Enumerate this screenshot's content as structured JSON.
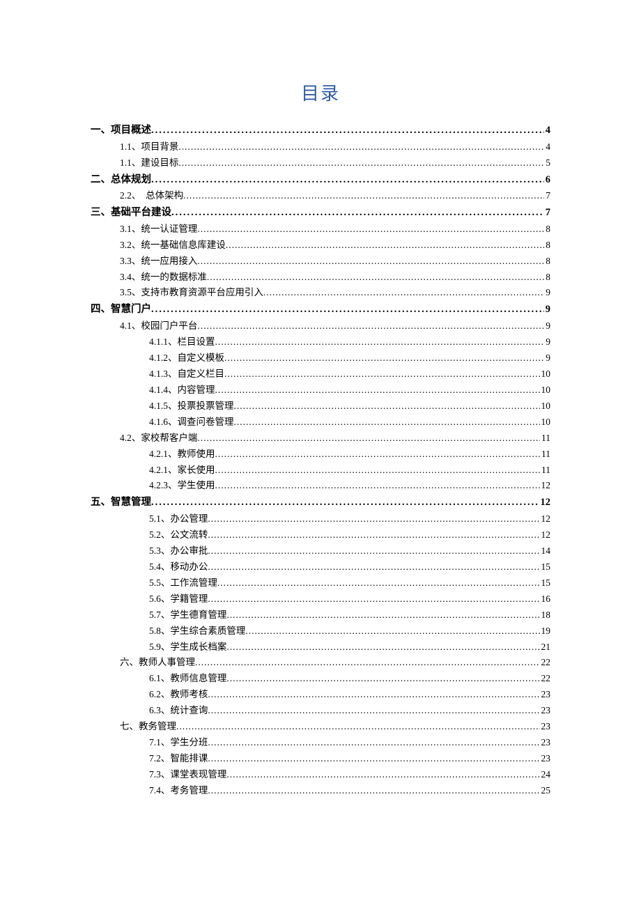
{
  "title": "目录",
  "entries": [
    {
      "level": 1,
      "label": "一、项目概述",
      "page": "4"
    },
    {
      "level": 2,
      "label": "1.1、项目背景",
      "page": "4"
    },
    {
      "level": 2,
      "label": "1.1、建设目标",
      "page": "5"
    },
    {
      "level": 1,
      "label": "二、总体规划",
      "page": "6"
    },
    {
      "level": 2,
      "label": "2.2、　总体架构",
      "page": "7"
    },
    {
      "level": 1,
      "label": "三、基础平台建设",
      "page": "7"
    },
    {
      "level": 2,
      "label": "3.1、统一认证管理",
      "page": "8"
    },
    {
      "level": 2,
      "label": "3.2、统一基础信息库建设",
      "page": "8"
    },
    {
      "level": 2,
      "label": "3.3、统一应用接入",
      "page": "8"
    },
    {
      "level": 2,
      "label": "3.4、统一的数据标准",
      "page": "8"
    },
    {
      "level": 2,
      "label": "3.5、支持市教育资源平台应用引入",
      "page": "9"
    },
    {
      "level": 1,
      "label": "四、智慧门户",
      "page": "9"
    },
    {
      "level": 2,
      "label": "4.1、校园门户平台",
      "page": "9"
    },
    {
      "level": 3,
      "label": "4.1.1、栏目设置",
      "page": "9"
    },
    {
      "level": 3,
      "label": "4.1.2、自定义模板",
      "page": "9"
    },
    {
      "level": 3,
      "label": "4.1.3、自定义栏目",
      "page": "10"
    },
    {
      "level": 3,
      "label": "4.1.4、内容管理",
      "page": "10"
    },
    {
      "level": 3,
      "label": "4.1.5、投票投票管理",
      "page": "10"
    },
    {
      "level": 3,
      "label": "4.1.6、调查问卷管理",
      "page": "10"
    },
    {
      "level": 2,
      "label": "4.2、家校帮客户端",
      "page": "11"
    },
    {
      "level": 3,
      "label": "4.2.1、教师使用",
      "page": "11"
    },
    {
      "level": 3,
      "label": "4.2.1、家长使用",
      "page": "11"
    },
    {
      "level": 3,
      "label": "4.2.3、学生使用",
      "page": "12"
    },
    {
      "level": 1,
      "label": "五、智慧管理",
      "page": "12"
    },
    {
      "level": 3,
      "label": "5.1、办公管理",
      "page": "12"
    },
    {
      "level": 3,
      "label": "5.2、公文流转",
      "page": "12"
    },
    {
      "level": 3,
      "label": "5.3、办公审批",
      "page": "14"
    },
    {
      "level": 3,
      "label": "5.4、移动办公",
      "page": "15"
    },
    {
      "level": 3,
      "label": "5.5、工作流管理",
      "page": "15"
    },
    {
      "level": 3,
      "label": "5.6、学籍管理",
      "page": "16"
    },
    {
      "level": 3,
      "label": "5.7、学生德育管理",
      "page": "18"
    },
    {
      "level": 3,
      "label": "5.8、学生综合素质管理",
      "page": "19"
    },
    {
      "level": 3,
      "label": "5.9、学生成长档案",
      "page": "21"
    },
    {
      "level": 2,
      "label": "六、教师人事管理",
      "page": "22"
    },
    {
      "level": 3,
      "label": "6.1、教师信息管理",
      "page": "22"
    },
    {
      "level": 3,
      "label": "6.2、教师考核",
      "page": "23"
    },
    {
      "level": 3,
      "label": "6.3、统计查询",
      "page": "23"
    },
    {
      "level": 2,
      "label": "七、教务管理",
      "page": "23"
    },
    {
      "level": 3,
      "label": "7.1、学生分班",
      "page": "23"
    },
    {
      "level": 3,
      "label": "7.2、智能排课",
      "page": "23"
    },
    {
      "level": 3,
      "label": "7.3、课堂表现管理",
      "page": "24"
    },
    {
      "level": 3,
      "label": "7.4、考务管理",
      "page": "25"
    }
  ]
}
